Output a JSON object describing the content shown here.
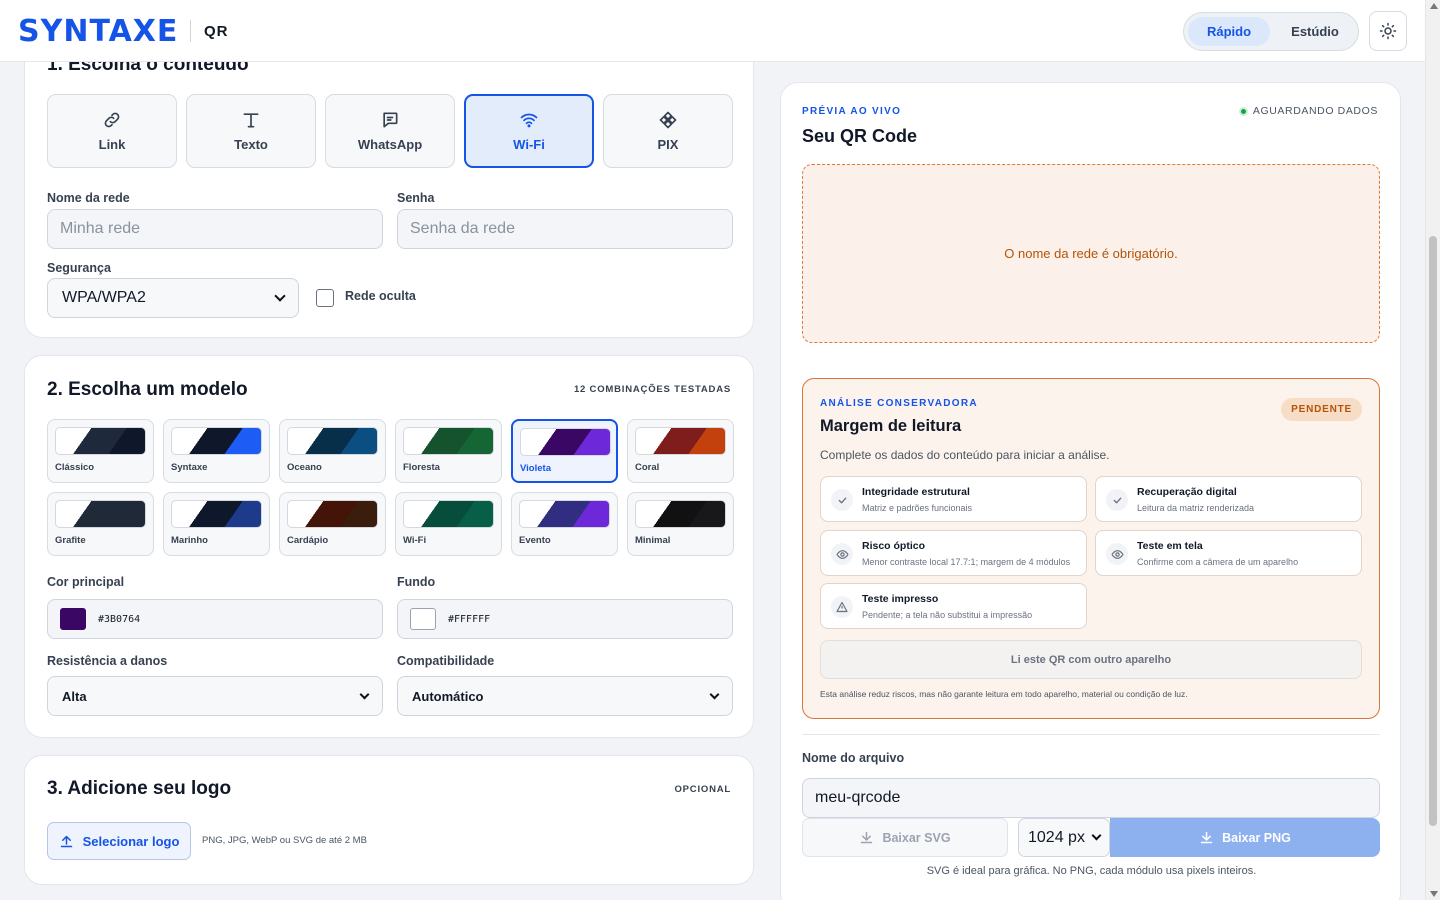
{
  "header": {
    "brand": "SYNTAXE",
    "product": "QR",
    "modes": [
      "Rápido",
      "Estúdio"
    ]
  },
  "step1": {
    "title": "1. Escolha o conteúdo",
    "types": [
      {
        "label": "Link",
        "icon": "link-icon"
      },
      {
        "label": "Texto",
        "icon": "text-icon"
      },
      {
        "label": "WhatsApp",
        "icon": "chat-icon"
      },
      {
        "label": "Wi-Fi",
        "icon": "wifi-icon"
      },
      {
        "label": "PIX",
        "icon": "pix-icon"
      }
    ],
    "network_label": "Nome da rede",
    "network_placeholder": "Minha rede",
    "password_label": "Senha",
    "password_placeholder": "Senha da rede",
    "security_label": "Segurança",
    "security_value": "WPA/WPA2",
    "hidden_label": "Rede oculta"
  },
  "step2": {
    "title": "2. Escolha um modelo",
    "tag": "12 COMBINAÇÕES TESTADAS",
    "templates": [
      {
        "name": "Clássico",
        "c1": "#1e293b",
        "c2": "#0f172a"
      },
      {
        "name": "Syntaxe",
        "c1": "#0f172a",
        "c2": "#1d5cf5"
      },
      {
        "name": "Oceano",
        "c1": "#082f49",
        "c2": "#0b4f82"
      },
      {
        "name": "Floresta",
        "c1": "#14532d",
        "c2": "#166534"
      },
      {
        "name": "Violeta",
        "c1": "#3b0764",
        "c2": "#6d28d9"
      },
      {
        "name": "Coral",
        "c1": "#7f1d1d",
        "c2": "#c2410c"
      },
      {
        "name": "Grafite",
        "c1": "#1f2937",
        "c2": "#1f2937"
      },
      {
        "name": "Marinho",
        "c1": "#0f172a",
        "c2": "#1e3a8a"
      },
      {
        "name": "Cardápio",
        "c1": "#431407",
        "c2": "#3b1d0e"
      },
      {
        "name": "Wi-Fi",
        "c1": "#064e3b",
        "c2": "#065f46"
      },
      {
        "name": "Evento",
        "c1": "#312e81",
        "c2": "#6d28d9"
      },
      {
        "name": "Minimal",
        "c1": "#111111",
        "c2": "#18181b"
      }
    ],
    "main_color_label": "Cor principal",
    "main_color": "#3B0764",
    "bg_label": "Fundo",
    "bg_color": "#FFFFFF",
    "resistance_label": "Resistência a danos",
    "resistance_value": "Alta",
    "compat_label": "Compatibilidade",
    "compat_value": "Automático"
  },
  "step3": {
    "title": "3. Adicione seu logo",
    "tag": "OPCIONAL",
    "button": "Selecionar logo",
    "hint": "PNG, JPG, WebP ou SVG de até 2 MB"
  },
  "preview": {
    "eyebrow": "PRÉVIA AO VIVO",
    "title": "Seu QR Code",
    "status": "AGUARDANDO DADOS",
    "error": "O nome da rede é obrigatório."
  },
  "analysis": {
    "eyebrow": "ANÁLISE CONSERVADORA",
    "title": "Margem de leitura",
    "badge": "PENDENTE",
    "description": "Complete os dados do conteúdo para iniciar a análise.",
    "checks": [
      {
        "title": "Integridade estrutural",
        "sub": "Matriz e padrões funcionais",
        "icon": "check-icon"
      },
      {
        "title": "Recuperação digital",
        "sub": "Leitura da matriz renderizada",
        "icon": "check-icon"
      },
      {
        "title": "Risco óptico",
        "sub": "Menor contraste local 17.7:1; margem de 4 módulos",
        "icon": "eye-icon"
      },
      {
        "title": "Teste em tela",
        "sub": "Confirme com a câmera de um aparelho",
        "icon": "eye-icon"
      },
      {
        "title": "Teste impresso",
        "sub": "Pendente; a tela não substitui a impressão",
        "icon": "warning-icon"
      }
    ],
    "read_button": "Li este QR com outro aparelho",
    "disclaimer": "Esta análise reduz riscos, mas não garante leitura em todo aparelho, material ou condição de luz."
  },
  "download": {
    "file_label": "Nome do arquivo",
    "file_value": "meu-qrcode",
    "svg_button": "Baixar SVG",
    "size_value": "1024 px",
    "png_button": "Baixar PNG",
    "note": "SVG é ideal para gráfica. No PNG, cada módulo usa pixels inteiros."
  }
}
